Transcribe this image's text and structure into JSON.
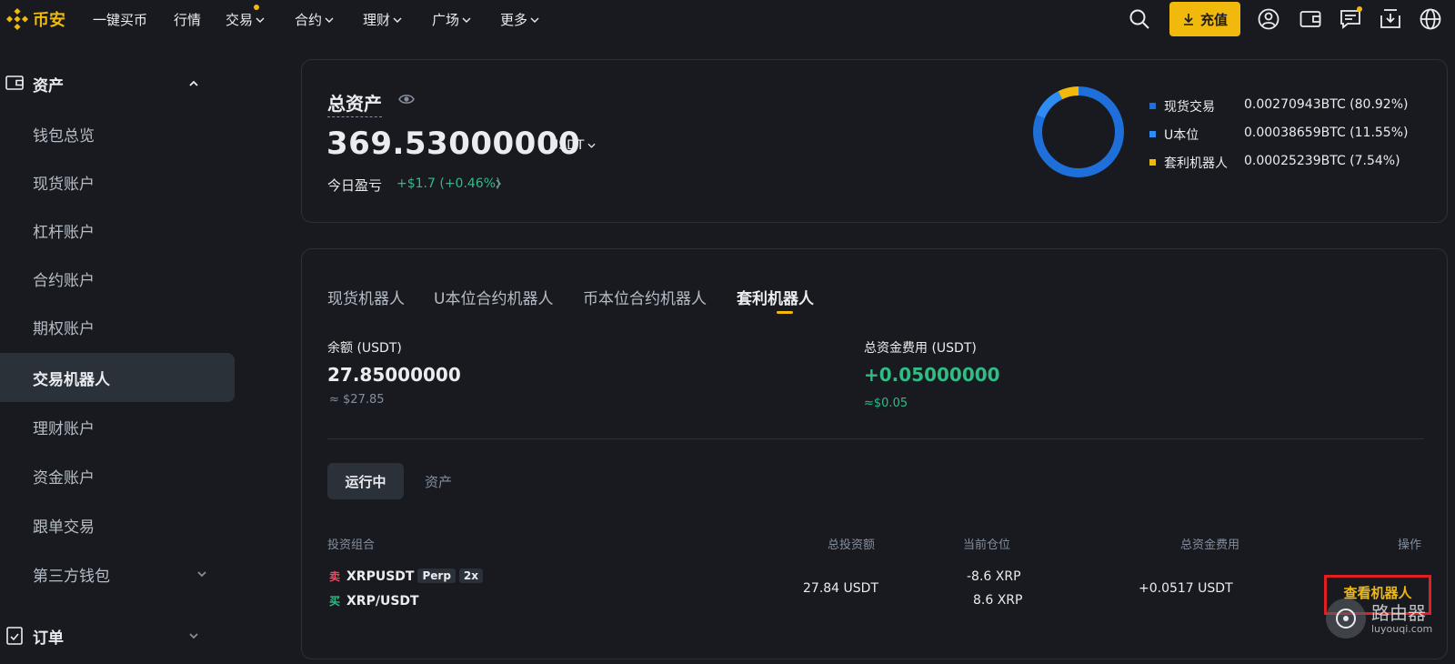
{
  "header": {
    "logo_text": "币安",
    "nav": [
      {
        "label": "一键买币"
      },
      {
        "label": "行情"
      },
      {
        "label": "交易"
      },
      {
        "label": "合约"
      },
      {
        "label": "理财"
      },
      {
        "label": "广场"
      },
      {
        "label": "更多"
      }
    ],
    "deposit_label": "充值",
    "icons": [
      "search-icon",
      "download-arrow-icon",
      "user-icon",
      "wallet-icon",
      "message-icon",
      "app-download-icon",
      "globe-icon"
    ]
  },
  "sidebar": {
    "assets_section": "资产",
    "items": [
      {
        "label": "钱包总览"
      },
      {
        "label": "现货账户"
      },
      {
        "label": "杠杆账户"
      },
      {
        "label": "合约账户"
      },
      {
        "label": "期权账户"
      },
      {
        "label": "交易机器人",
        "active": true
      },
      {
        "label": "理财账户"
      },
      {
        "label": "资金账户"
      },
      {
        "label": "跟单交易"
      },
      {
        "label": "第三方钱包"
      }
    ],
    "orders_section": "订单"
  },
  "summary": {
    "title": "总资产",
    "total": "369.53000000",
    "currency": "USDT",
    "pnl_label": "今日盈亏",
    "pnl_value": "+$1.7 (+0.46%)",
    "allocation": [
      {
        "name": "现货交易",
        "value": "0.00270943BTC (80.92%)",
        "percent": 80.92,
        "color": "#1e6fd9"
      },
      {
        "name": "U本位",
        "value": "0.00038659BTC (11.55%)",
        "percent": 11.55,
        "color": "#2f8cf2"
      },
      {
        "name": "套利机器人",
        "value": "0.00025239BTC (7.54%)",
        "percent": 7.54,
        "color": "#f0b90b"
      }
    ]
  },
  "bots": {
    "tabs": [
      {
        "label": "现货机器人"
      },
      {
        "label": "U本位合约机器人"
      },
      {
        "label": "币本位合约机器人"
      },
      {
        "label": "套利机器人",
        "active": true
      }
    ],
    "balance_label": "余额 (USDT)",
    "balance_value": "27.85000000",
    "balance_approx": "≈ $27.85",
    "funding_label": "总资金费用 (USDT)",
    "funding_value": "+0.05000000",
    "funding_approx": "≈$0.05",
    "sub_tabs": [
      {
        "label": "运行中",
        "active": true
      },
      {
        "label": "资产"
      }
    ],
    "columns": [
      "投资组合",
      "总投资额",
      "当前仓位",
      "总资金费用",
      "操作"
    ],
    "row": {
      "sell_badge": "卖",
      "pair1": "XRPUSDT",
      "tag_perp": "Perp",
      "tag_leverage": "2x",
      "buy_badge": "买",
      "pair2": "XRP/USDT",
      "investment": "27.84 USDT",
      "position1": "-8.6 XRP",
      "position2": "8.6 XRP",
      "funding": "+0.0517 USDT",
      "action": "查看机器人"
    }
  },
  "watermark": {
    "line1": "路由器",
    "line2": "luyouqi.com"
  }
}
